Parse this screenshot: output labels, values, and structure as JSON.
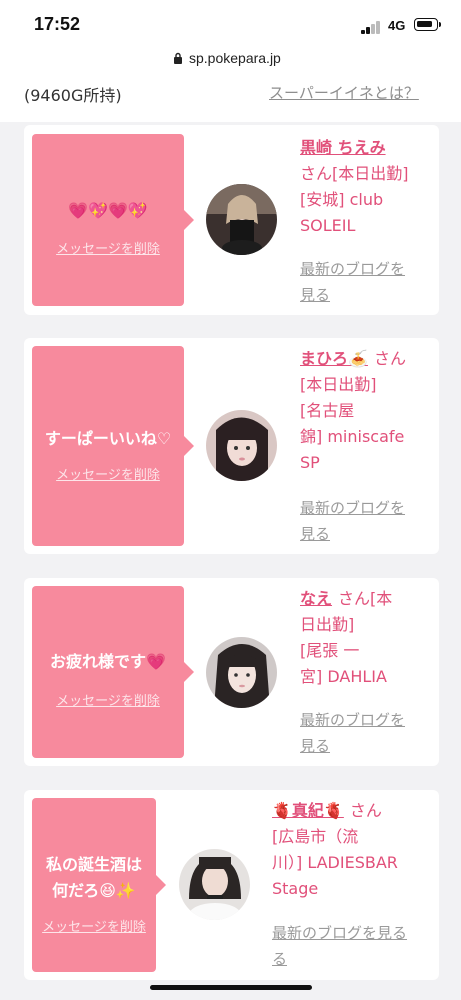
{
  "status_bar": {
    "time": "17:52",
    "network": "4G"
  },
  "browser": {
    "url": "sp.pokepara.jp"
  },
  "header": {
    "points": "(9460G所持)",
    "help_link": "スーパーイイネとは？"
  },
  "cards": [
    {
      "message": "💗💖💗💖",
      "delete_label": "メッセージを削除",
      "name": "黒崎 ちえみ",
      "name_suffix": "さん",
      "status": "[本日出勤]",
      "shop_line1": "[安城] club",
      "shop_line2": "SOLEIL",
      "blog_line1": "最新のブログを",
      "blog_line2": "見る"
    },
    {
      "message": "すーぱーいいね♡",
      "delete_label": "メッセージを削除",
      "name": "まひろ🍝",
      "name_suffix": "さん",
      "status": "[本日出勤]",
      "shop_line1": "[名古屋",
      "shop_line2": "錦] miniscafe",
      "shop_line3": "SP",
      "blog_line1": "最新のブログを",
      "blog_line2": "見る"
    },
    {
      "message": "お疲れ様です💗",
      "delete_label": "メッセージを削除",
      "name": "なえ",
      "name_suffix": "さん[本",
      "status": "日出勤]",
      "shop_line1": "[尾張 一",
      "shop_line2": "宮] DAHLIA",
      "blog_line1": "最新のブログを",
      "blog_line2": "見る"
    },
    {
      "message_line1": "私の誕生酒は",
      "message_line2": "何だろ😆✨",
      "delete_label": "メッセージを削除",
      "name": "🫀真紀🫀",
      "name_suffix": "さん",
      "status": "[広島市（流",
      "shop_line1": "川）] LADIESBAR",
      "shop_line2": "Stage",
      "blog_line1": "最新のブログを見る",
      "blog_line2": "る"
    }
  ],
  "colors": {
    "accent_pink": "#f78a9d",
    "name_pink": "#e1507a",
    "link_gray": "#9a9a9a"
  }
}
